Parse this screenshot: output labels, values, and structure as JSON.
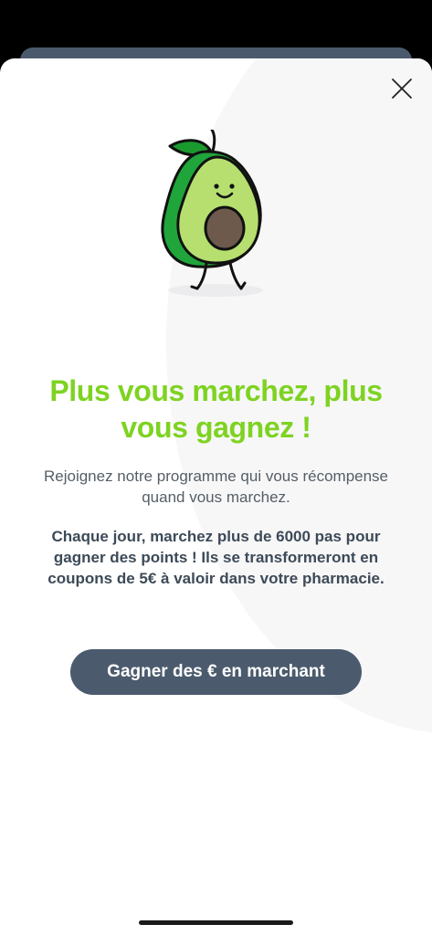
{
  "modal": {
    "close_icon": "close-icon",
    "illustration": "avocado-mascot",
    "headline": "Plus vous marchez, plus vous gagnez !",
    "intro": "Rejoignez notre programme qui vous récompense quand vous marchez.",
    "details": "Chaque jour, marchez plus de 6000 pas pour gagner des points ! Ils se transformeront en coupons de 5€ à valoir dans votre pharmacie.",
    "cta_label": "Gagner des € en marchant"
  },
  "colors": {
    "accent_green": "#7ed321",
    "button": "#4b5b6d",
    "body_text": "#555e66",
    "strong_text": "#3d4a57"
  }
}
